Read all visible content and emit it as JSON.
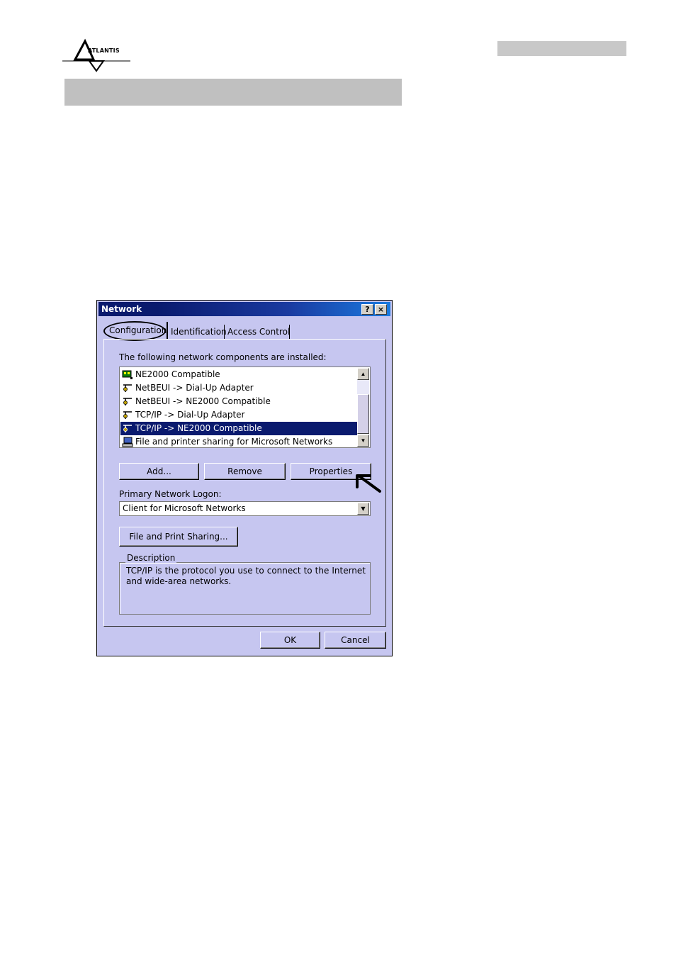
{
  "header": {
    "logo_text": "ATLANTIS"
  },
  "window": {
    "title": "Network",
    "help_button": "?",
    "close_button": "×",
    "tabs": [
      {
        "label": "Configuration",
        "active": true
      },
      {
        "label": "Identification",
        "active": false
      },
      {
        "label": "Access Control",
        "active": false
      }
    ],
    "components_label": "The following network components are installed:",
    "components": [
      {
        "label": "NE2000 Compatible",
        "icon": "network-adapter-icon",
        "selected": false
      },
      {
        "label": "NetBEUI -> Dial-Up Adapter",
        "icon": "protocol-icon",
        "selected": false
      },
      {
        "label": "NetBEUI -> NE2000 Compatible",
        "icon": "protocol-icon",
        "selected": false
      },
      {
        "label": "TCP/IP -> Dial-Up Adapter",
        "icon": "protocol-icon",
        "selected": false
      },
      {
        "label": "TCP/IP -> NE2000 Compatible",
        "icon": "protocol-icon",
        "selected": true
      },
      {
        "label": "File and printer sharing for Microsoft Networks",
        "icon": "sharing-icon",
        "selected": false
      }
    ],
    "buttons": {
      "add": "Add...",
      "remove": "Remove",
      "properties": "Properties"
    },
    "primary_logon_label": "Primary Network Logon:",
    "primary_logon_value": "Client for Microsoft Networks",
    "file_print_sharing": "File and Print Sharing...",
    "description_title": "Description",
    "description_text": "TCP/IP is the protocol you use to connect to the Internet and wide-area networks.",
    "ok": "OK",
    "cancel": "Cancel"
  },
  "colors": {
    "dialog_bg": "#c6c6f0",
    "title_dark": "#0a1a6e",
    "title_light": "#1a7ae0",
    "selection": "#0a1a6e"
  }
}
